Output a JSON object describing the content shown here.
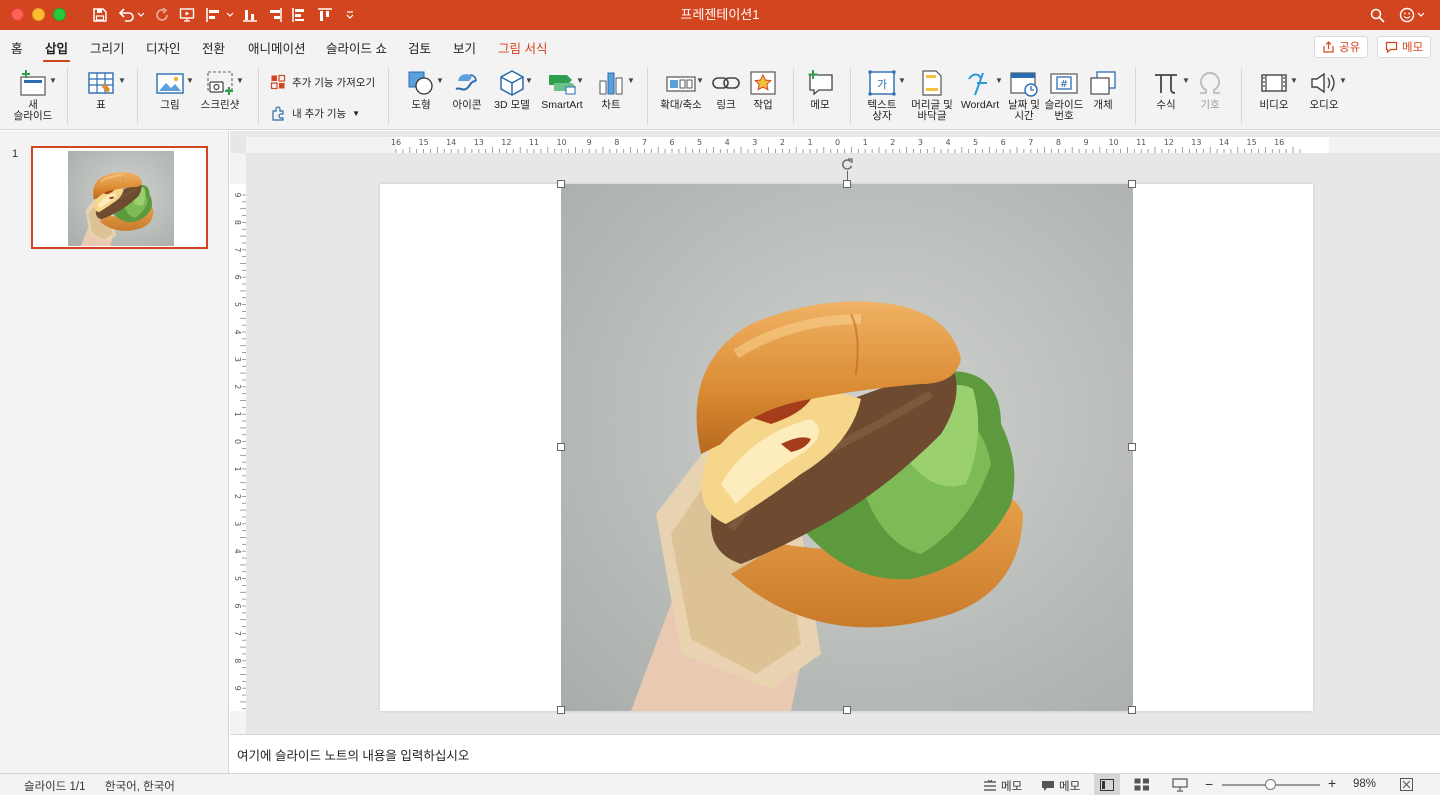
{
  "window": {
    "title": "프레젠테이션1"
  },
  "tabs": [
    {
      "label": "홈"
    },
    {
      "label": "삽입"
    },
    {
      "label": "그리기"
    },
    {
      "label": "디자인"
    },
    {
      "label": "전환"
    },
    {
      "label": "애니메이션"
    },
    {
      "label": "슬라이드 쇼"
    },
    {
      "label": "검토"
    },
    {
      "label": "보기"
    },
    {
      "label": "그림 서식"
    }
  ],
  "header": {
    "share_label": "공유",
    "comment_label": "메모"
  },
  "ribbon": {
    "new_slide": "새\n슬라이드",
    "new_slide_line1": "새",
    "new_slide_line2": "슬라이드",
    "table": "표",
    "picture": "그림",
    "screenshot": "스크린샷",
    "get_addins": "추가 기능 가져오기",
    "my_addins": "내 추가 기능",
    "shapes": "도형",
    "icons": "아이콘",
    "model_3d": "3D 모델",
    "smartart": "SmartArt",
    "chart": "차트",
    "zoom": "확대/축소",
    "link": "링크",
    "action": "작업",
    "comment": "메모",
    "textbox_line1": "텍스트",
    "textbox_line2": "상자",
    "header_line1": "머리글 및",
    "header_line2": "바닥글",
    "wordart": "WordArt",
    "datetime_line1": "날짜 및",
    "datetime_line2": "시간",
    "slidenum_line1": "슬라이드",
    "slidenum_line2": "번호",
    "object": "개체",
    "equation": "수식",
    "symbol": "기호",
    "video": "비디오",
    "audio": "오디오"
  },
  "ruler": {
    "h_ticks": [
      "16",
      "15",
      "14",
      "13",
      "12",
      "11",
      "10",
      "9",
      "8",
      "7",
      "6",
      "5",
      "4",
      "3",
      "2",
      "1",
      "0",
      "1",
      "2",
      "3",
      "4",
      "5",
      "6",
      "7",
      "8",
      "9",
      "10",
      "11",
      "12",
      "13",
      "14",
      "15",
      "16"
    ],
    "v_ticks": [
      "9",
      "8",
      "7",
      "6",
      "5",
      "4",
      "3",
      "2",
      "1",
      "0",
      "1",
      "2",
      "3",
      "4",
      "5",
      "6",
      "7",
      "8",
      "9"
    ]
  },
  "thumbnails": [
    {
      "number": "1"
    }
  ],
  "notes": {
    "placeholder": "여기에 슬라이드 노트의 내용을 입력하십시오"
  },
  "status": {
    "slide_counter": "슬라이드 1/1",
    "language": "한국어, 한국어",
    "notes_label": "메모",
    "comments_label": "메모",
    "zoom": "98%",
    "zoom_level": 0.49
  },
  "colors": {
    "accent": "#d2451f",
    "ribbon_bg": "#f3f3f3",
    "icon_blue": "#2b6cb0",
    "icon_green": "#2e9e4f"
  }
}
